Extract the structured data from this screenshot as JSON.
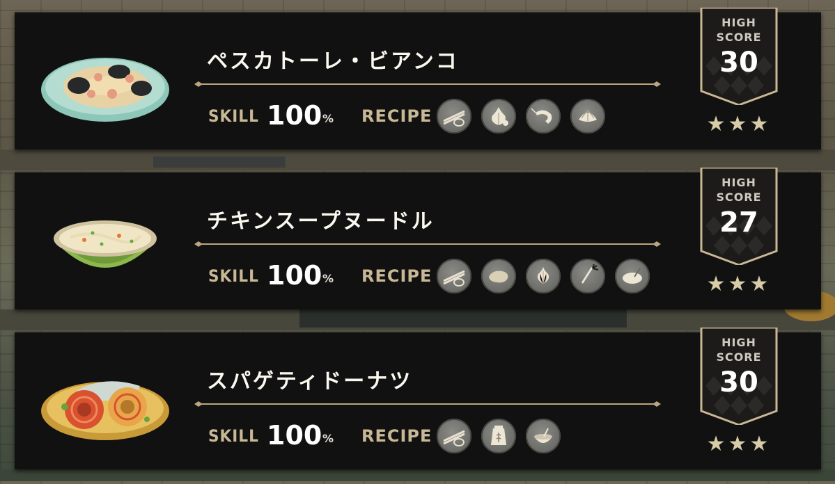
{
  "labels": {
    "skill": "SKILL",
    "recipe": "RECIPE",
    "high": "HIGH",
    "score": "SCORE",
    "percent": "%"
  },
  "colors": {
    "panel": "#121111",
    "accent_gold": "#c9b894",
    "divider": "#b9a67f",
    "text_white": "#fbf8ef"
  },
  "dishes": [
    {
      "name": "ペスカトーレ・ビアンコ",
      "skill": "100",
      "high_score": "30",
      "stars": "★★★",
      "dish_icon": "pescatore-pasta-plate",
      "ingredients": [
        "pasta-icon",
        "garlic-icon",
        "shrimp-icon",
        "clam-icon"
      ]
    },
    {
      "name": "チキンスープヌードル",
      "skill": "100",
      "high_score": "27",
      "stars": "★★★",
      "dish_icon": "chicken-noodle-soup-bowl",
      "ingredients": [
        "pasta-icon",
        "chicken-icon",
        "onion-icon",
        "carrot-icon",
        "broth-icon"
      ]
    },
    {
      "name": "スパゲティドーナツ",
      "skill": "100",
      "high_score": "30",
      "stars": "★★★",
      "dish_icon": "spaghetti-donut-plate",
      "ingredients": [
        "pasta-icon",
        "flour-bag-icon",
        "bowl-icon"
      ]
    }
  ]
}
